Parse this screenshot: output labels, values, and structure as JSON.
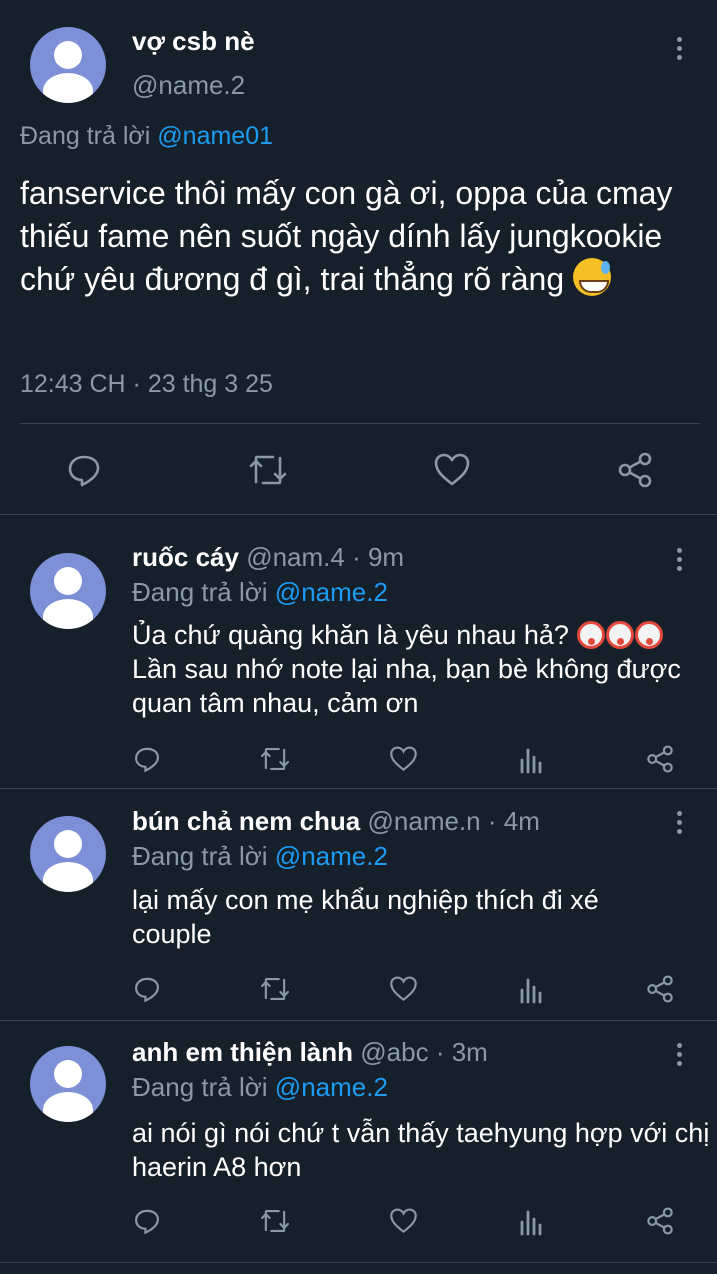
{
  "main_tweet": {
    "display_name": "vợ csb nè",
    "handle": "@name.2",
    "replying_prefix": "Đang trả lời",
    "replying_to": "@name01",
    "text": "fanservice thôi mấy con gà ơi, oppa của cmay thiếu fame nên suốt ngày dính lấy jungkookie chứ yêu đương đ gì, trai thẳng rõ ràng",
    "emoji": "sweat-smile",
    "timestamp": "12:43 CH · 23 thg 3 25",
    "actions": [
      "reply-icon",
      "retweet-icon",
      "like-icon",
      "share-icon"
    ]
  },
  "replies": [
    {
      "display_name": "ruốc cáy",
      "handle": "@nam.4",
      "time": "· 9m",
      "replying_prefix": "Đang trả lời",
      "replying_to": "@name.2",
      "text_line1": "Ủa chứ quàng khăn là yêu nhau hả?",
      "emoji": "clown-face x3",
      "text_rest": "Lần sau nhớ note lại nha, bạn bè không được quan tâm nhau, cảm ơn"
    },
    {
      "display_name": "bún chả nem chua",
      "handle": "@name.n",
      "time": "· 4m",
      "replying_prefix": "Đang trả lời",
      "replying_to": "@name.2",
      "text": "lại mấy con mẹ khẩu nghiệp thích đi xé couple"
    },
    {
      "display_name": "anh em thiện lành",
      "handle": "@abc",
      "time": "· 3m",
      "replying_prefix": "Đang trả lời",
      "replying_to": "@name.2",
      "text": "ai nói gì nói chứ t vẫn thấy taehyung hợp với chị haerin A8 hơn"
    }
  ],
  "colors": {
    "background": "#15202b",
    "text": "#ffffff",
    "secondary": "#8b98a5",
    "accent": "#1d9bf0",
    "divider": "#38444d"
  }
}
